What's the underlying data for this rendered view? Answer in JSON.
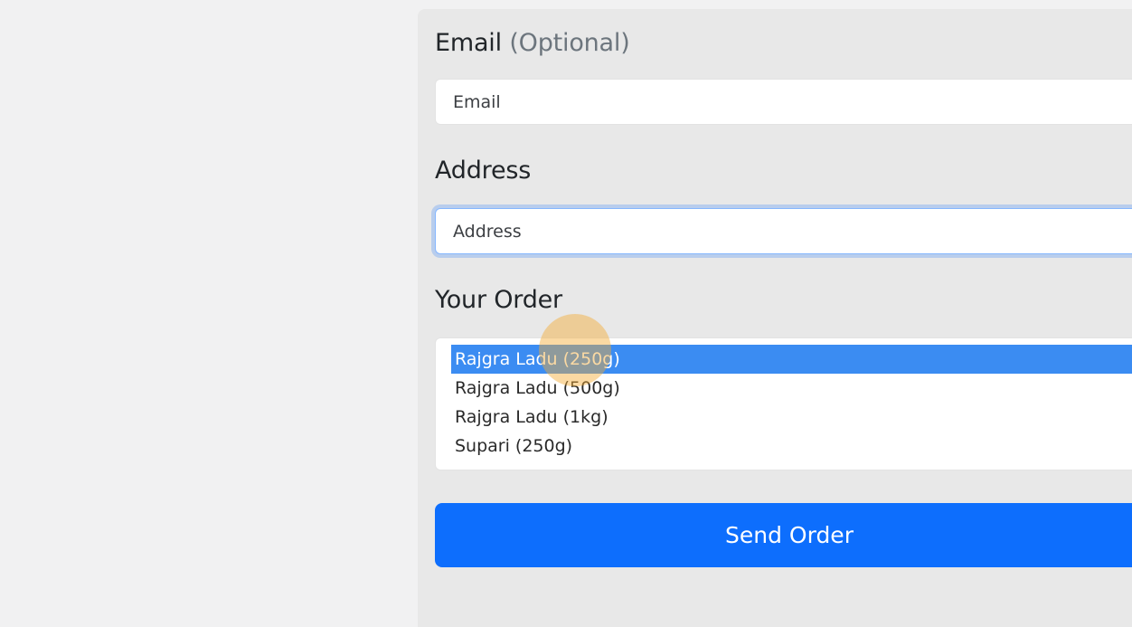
{
  "form": {
    "email": {
      "label": "Email",
      "label_hint": "(Optional)",
      "placeholder": "Email",
      "value": ""
    },
    "address": {
      "label": "Address",
      "placeholder": "Address",
      "value": "",
      "focused": true
    },
    "order": {
      "label": "Your Order",
      "options": [
        "Rajgra Ladu (250g)",
        "Rajgra Ladu (500g)",
        "Rajgra Ladu (1kg)",
        "Supari (250g)"
      ],
      "selected": "Rajgra Ladu (250g)"
    },
    "submit_label": "Send Order"
  },
  "colors": {
    "page_bg": "#f1f1f2",
    "panel_bg": "#e8e8e8",
    "primary": "#0d6efd",
    "selected_option_bg": "#3b8cf2",
    "focus_ring": "#86b7fe",
    "label_muted": "#6c757d"
  }
}
